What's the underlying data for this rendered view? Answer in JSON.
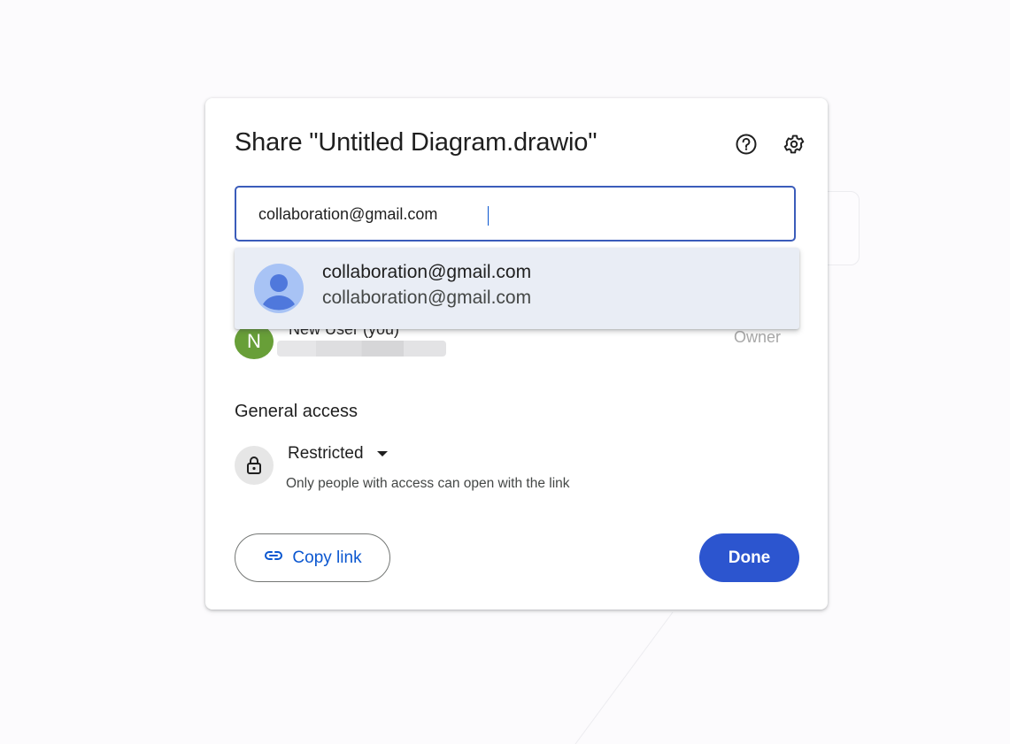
{
  "dialog": {
    "title": "Share \"Untitled Diagram.drawio\"",
    "help_icon": "help-circle-icon",
    "settings_icon": "gear-icon"
  },
  "search": {
    "value": "collaboration@gmail.com"
  },
  "suggestion": {
    "name": "collaboration@gmail.com",
    "email": "collaboration@gmail.com",
    "avatar_icon": "person-avatar-icon"
  },
  "people": {
    "owner": {
      "initial": "N",
      "name": "New User (you)",
      "role": "Owner"
    }
  },
  "general_access": {
    "heading": "General access",
    "level": "Restricted",
    "description": "Only people with access can open with the link",
    "icon": "lock-icon"
  },
  "actions": {
    "copy_link": "Copy link",
    "copy_link_icon": "link-icon",
    "done": "Done"
  },
  "colors": {
    "accent": "#2c55cf",
    "link": "#0b57d0",
    "suggestion_bg": "#e9edf5",
    "owner_avatar": "#689f38"
  }
}
